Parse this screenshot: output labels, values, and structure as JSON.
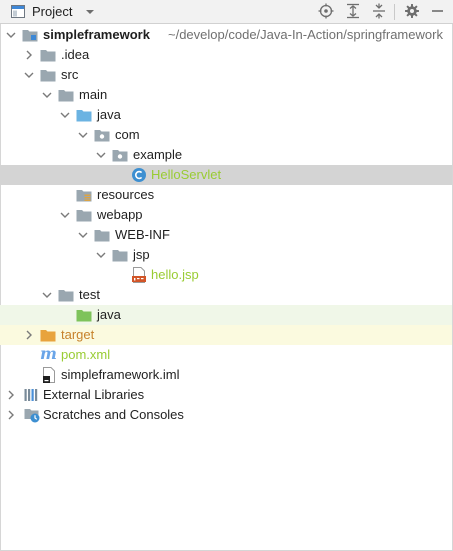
{
  "header": {
    "title": "Project"
  },
  "tree": {
    "root": {
      "label": "simpleframework",
      "path": "~/develop/code/Java-In-Action/springframework"
    },
    "idea": {
      "label": ".idea"
    },
    "src": {
      "label": "src"
    },
    "main": {
      "label": "main"
    },
    "java": {
      "label": "java"
    },
    "com": {
      "label": "com"
    },
    "example": {
      "label": "example"
    },
    "hello_servlet": {
      "label": "HelloServlet"
    },
    "resources": {
      "label": "resources"
    },
    "webapp": {
      "label": "webapp"
    },
    "web_inf": {
      "label": "WEB-INF"
    },
    "jsp": {
      "label": "jsp"
    },
    "hello_jsp": {
      "label": "hello.jsp"
    },
    "test": {
      "label": "test"
    },
    "test_java": {
      "label": "java"
    },
    "target": {
      "label": "target"
    },
    "pom": {
      "label": "pom.xml"
    },
    "iml": {
      "label": "simpleframework.iml"
    },
    "ext_libs": {
      "label": "External Libraries"
    },
    "scratches": {
      "label": "Scratches and Consoles"
    }
  },
  "colors": {
    "folder": "#9aa7b0",
    "source_folder": "#6bb3e2",
    "test_folder": "#7ec35b",
    "excluded_folder": "#e8a33d",
    "selection": "#d4d4d4",
    "vcs_added": "#99cc33"
  }
}
